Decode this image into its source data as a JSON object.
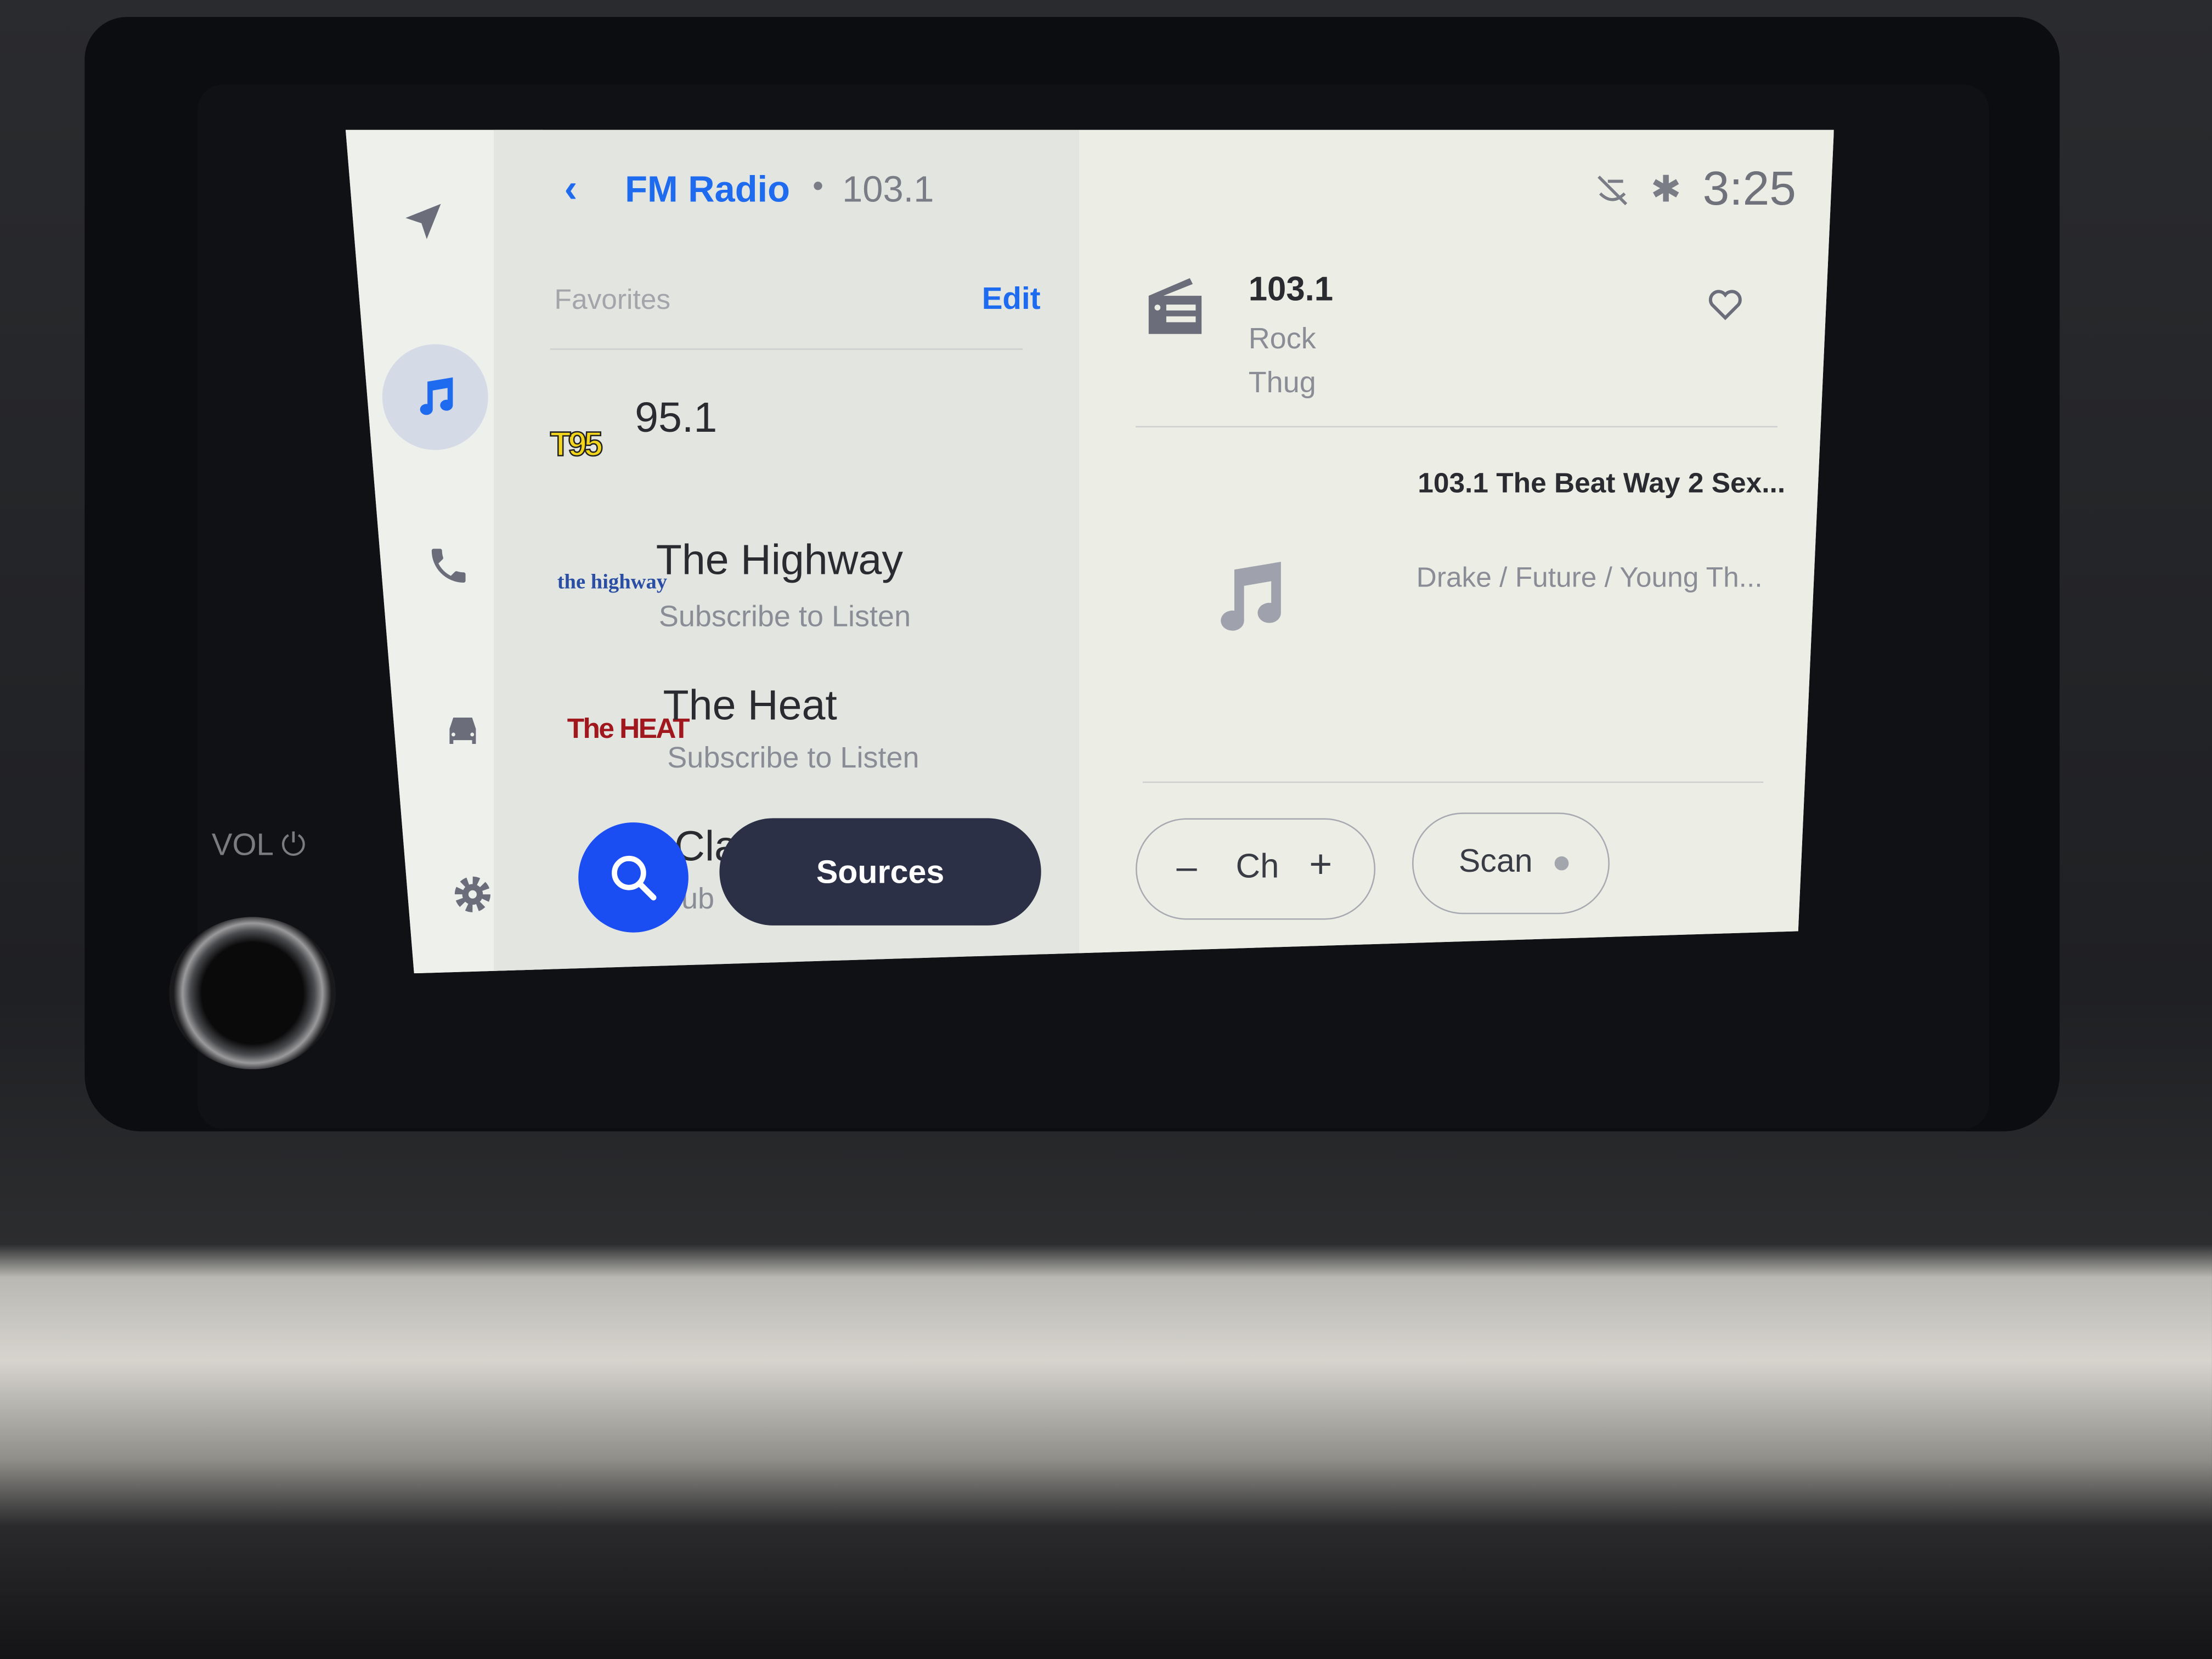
{
  "header": {
    "back_icon": "chevron-left-icon",
    "title": "FM Radio",
    "separator": "•",
    "frequency": "103.1"
  },
  "sidebar": {
    "items": [
      {
        "name": "navigation",
        "icon": "navigation-arrow-icon"
      },
      {
        "name": "music",
        "icon": "music-note-icon",
        "active": true
      },
      {
        "name": "phone",
        "icon": "phone-icon"
      },
      {
        "name": "vehicle",
        "icon": "car-icon"
      },
      {
        "name": "settings",
        "icon": "gear-icon"
      }
    ]
  },
  "favorites": {
    "label": "Favorites",
    "edit_label": "Edit",
    "items": [
      {
        "logo": "T95",
        "title": "95.1",
        "subtitle": ""
      },
      {
        "logo": "the highway",
        "title": "The Highway",
        "subtitle": "Subscribe to Listen"
      },
      {
        "logo": "The HEAT",
        "title": "The Heat",
        "subtitle": "Subscribe to Listen"
      },
      {
        "title": "Cla",
        "subtitle": "ub"
      }
    ]
  },
  "actions": {
    "search_icon": "search-icon",
    "sources_label": "Sources"
  },
  "status": {
    "icons": [
      "voice-muted-icon",
      "bluetooth-icon"
    ],
    "time": "3:25"
  },
  "now_playing": {
    "frequency": "103.1",
    "genre": "Rock",
    "station_name": "Thug",
    "song_title": "103.1 The Beat Way 2 Sex...",
    "artist": "Drake / Future / Young Th...",
    "favorite_icon": "heart-outline-icon"
  },
  "controls": {
    "minus": "–",
    "channel_label": "Ch",
    "plus": "+",
    "scan_label": "Scan"
  },
  "hardware": {
    "vol_label": "VOL"
  },
  "colors": {
    "accent": "#1f6bf0",
    "sources_bg": "#2b3046",
    "search_bg": "#1a4df2"
  }
}
